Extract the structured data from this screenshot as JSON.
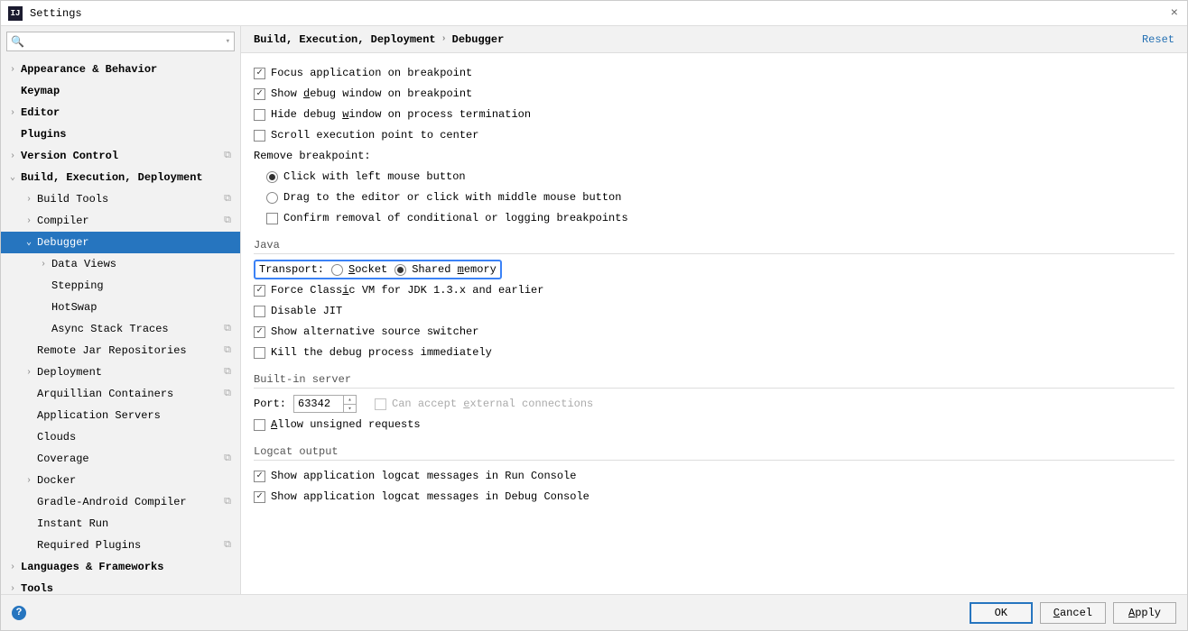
{
  "window": {
    "title": "Settings"
  },
  "search": {
    "placeholder": ""
  },
  "sidebar": {
    "items": [
      {
        "label": "Appearance & Behavior",
        "lvl": 0,
        "arrow": "›",
        "bold": true
      },
      {
        "label": "Keymap",
        "lvl": 0,
        "arrow": "",
        "bold": true
      },
      {
        "label": "Editor",
        "lvl": 0,
        "arrow": "›",
        "bold": true
      },
      {
        "label": "Plugins",
        "lvl": 0,
        "arrow": "",
        "bold": true
      },
      {
        "label": "Version Control",
        "lvl": 0,
        "arrow": "›",
        "bold": true,
        "proj": true
      },
      {
        "label": "Build, Execution, Deployment",
        "lvl": 0,
        "arrow": "⌄",
        "bold": true
      },
      {
        "label": "Build Tools",
        "lvl": 1,
        "arrow": "›",
        "proj": true
      },
      {
        "label": "Compiler",
        "lvl": 1,
        "arrow": "›",
        "proj": true
      },
      {
        "label": "Debugger",
        "lvl": 1,
        "arrow": "⌄",
        "selected": true
      },
      {
        "label": "Data Views",
        "lvl": 2,
        "arrow": "›"
      },
      {
        "label": "Stepping",
        "lvl": 2,
        "arrow": ""
      },
      {
        "label": "HotSwap",
        "lvl": 2,
        "arrow": ""
      },
      {
        "label": "Async Stack Traces",
        "lvl": 2,
        "arrow": "",
        "proj": true
      },
      {
        "label": "Remote Jar Repositories",
        "lvl": 1,
        "arrow": "",
        "proj": true
      },
      {
        "label": "Deployment",
        "lvl": 1,
        "arrow": "›",
        "proj": true
      },
      {
        "label": "Arquillian Containers",
        "lvl": 1,
        "arrow": "",
        "proj": true
      },
      {
        "label": "Application Servers",
        "lvl": 1,
        "arrow": ""
      },
      {
        "label": "Clouds",
        "lvl": 1,
        "arrow": ""
      },
      {
        "label": "Coverage",
        "lvl": 1,
        "arrow": "",
        "proj": true
      },
      {
        "label": "Docker",
        "lvl": 1,
        "arrow": "›"
      },
      {
        "label": "Gradle-Android Compiler",
        "lvl": 1,
        "arrow": "",
        "proj": true
      },
      {
        "label": "Instant Run",
        "lvl": 1,
        "arrow": ""
      },
      {
        "label": "Required Plugins",
        "lvl": 1,
        "arrow": "",
        "proj": true
      },
      {
        "label": "Languages & Frameworks",
        "lvl": 0,
        "arrow": "›",
        "bold": true
      },
      {
        "label": "Tools",
        "lvl": 0,
        "arrow": "›",
        "bold": true
      }
    ]
  },
  "breadcrumb": {
    "root": "Build, Execution, Deployment",
    "leaf": "Debugger",
    "reset": "Reset"
  },
  "opts": {
    "focus_app": "Focus application on breakpoint",
    "show_debug_pre": "Show ",
    "show_debug_u": "d",
    "show_debug_post": "ebug window on breakpoint",
    "hide_debug_pre": "Hide debug ",
    "hide_debug_u": "w",
    "hide_debug_post": "indow on process termination",
    "scroll_exec": "Scroll execution point to center",
    "remove_bp": "Remove breakpoint:",
    "rb_click": "Click with left mouse button",
    "rb_drag": "Drag to the editor or click with middle mouse button",
    "confirm_removal": "Confirm removal of conditional or logging breakpoints"
  },
  "java": {
    "title": "Java",
    "transport": "Transport:",
    "socket_pre": "",
    "socket_u": "S",
    "socket_post": "ocket",
    "shared_pre": "Shared ",
    "shared_u": "m",
    "shared_post": "emory",
    "force_pre": "Force Class",
    "force_u": "i",
    "force_post": "c VM for JDK 1.3.x and earlier",
    "disable_jit": "Disable JIT",
    "alt_source": "Show alternative source switcher",
    "kill_debug": "Kill the debug process immediately"
  },
  "server": {
    "title": "Built-in server",
    "port_label": "Port:",
    "port_value": "63342",
    "can_accept_pre": "Can accept ",
    "can_accept_u": "e",
    "can_accept_post": "xternal connections",
    "allow_pre": "",
    "allow_u": "A",
    "allow_post": "llow unsigned requests"
  },
  "logcat": {
    "title": "Logcat output",
    "run": "Show application logcat messages in Run Console",
    "debug": "Show application logcat messages in Debug Console"
  },
  "footer": {
    "ok": "OK",
    "cancel_u": "C",
    "cancel_post": "ancel",
    "apply_u": "A",
    "apply_post": "pply"
  }
}
